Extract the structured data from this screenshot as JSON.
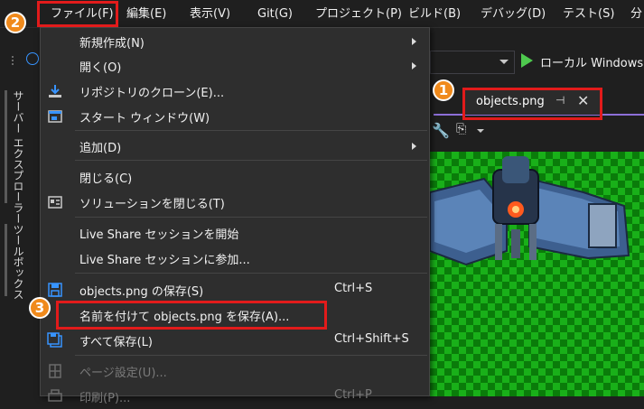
{
  "menubar": {
    "items": [
      "ファイル(F)",
      "編集(E)",
      "表示(V)",
      "Git(G)",
      "プロジェクト(P)",
      "ビルド(B)",
      "デバッグ(D)",
      "テスト(S)",
      "分"
    ]
  },
  "toolbar": {
    "run_label": "ローカル Windows"
  },
  "side_tabs": [
    "サーバー エクスプローラー",
    "ツールボックス"
  ],
  "doc_tab": {
    "label": "objects.png"
  },
  "file_menu": {
    "items": [
      {
        "label": "新規作成(N)",
        "shortcut": "",
        "submenu": true,
        "disabled": false
      },
      {
        "label": "開く(O)",
        "shortcut": "",
        "submenu": true,
        "disabled": false
      },
      {
        "label": "リポジトリのクローン(E)...",
        "shortcut": "",
        "submenu": false,
        "disabled": false
      },
      {
        "label": "スタート ウィンドウ(W)",
        "shortcut": "",
        "submenu": false,
        "disabled": false
      },
      {
        "label": "追加(D)",
        "shortcut": "",
        "submenu": true,
        "disabled": false
      },
      {
        "label": "閉じる(C)",
        "shortcut": "",
        "submenu": false,
        "disabled": false
      },
      {
        "label": "ソリューションを閉じる(T)",
        "shortcut": "",
        "submenu": false,
        "disabled": false
      },
      {
        "label": "Live Share セッションを開始",
        "shortcut": "",
        "submenu": false,
        "disabled": false
      },
      {
        "label": "Live Share セッションに参加...",
        "shortcut": "",
        "submenu": false,
        "disabled": false
      },
      {
        "label": "objects.png の保存(S)",
        "shortcut": "Ctrl+S",
        "submenu": false,
        "disabled": false
      },
      {
        "label": "名前を付けて objects.png を保存(A)...",
        "shortcut": "",
        "submenu": false,
        "disabled": false
      },
      {
        "label": "すべて保存(L)",
        "shortcut": "Ctrl+Shift+S",
        "submenu": false,
        "disabled": false
      },
      {
        "label": "ページ設定(U)...",
        "shortcut": "",
        "submenu": false,
        "disabled": true
      },
      {
        "label": "印刷(P)...",
        "shortcut": "Ctrl+P",
        "submenu": false,
        "disabled": true
      }
    ]
  },
  "badges": [
    "1",
    "2",
    "3"
  ],
  "colors": {
    "highlight": "#e21b1b",
    "badge": "#f08a1c",
    "accent": "#8d6fd8",
    "run": "#4ec94e"
  }
}
